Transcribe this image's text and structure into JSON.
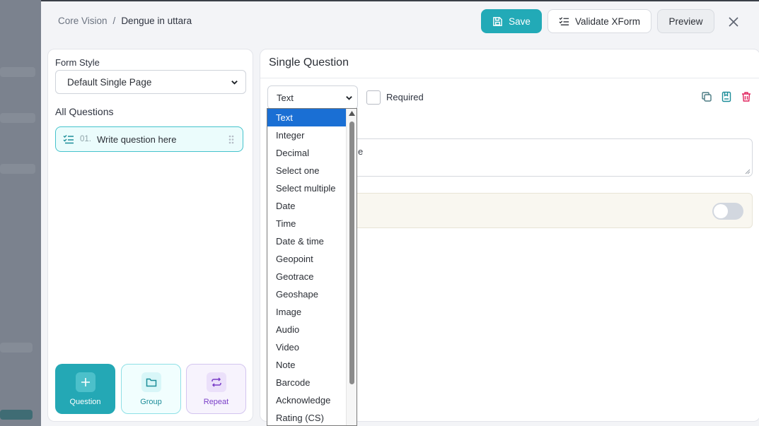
{
  "breadcrumb": {
    "parent": "Core Vision",
    "separator": "/",
    "current": "Dengue in uttara"
  },
  "toolbar": {
    "save_label": "Save",
    "validate_label": "Validate XForm",
    "preview_label": "Preview"
  },
  "sidebar": {
    "form_style_label": "Form Style",
    "form_style_value": "Default Single Page",
    "all_questions_label": "All Questions",
    "questions": [
      {
        "number": "01.",
        "text": "Write question here"
      }
    ],
    "add_buttons": {
      "question": "Question",
      "group": "Group",
      "repeat": "Repeat"
    }
  },
  "main": {
    "title": "Single Question",
    "question_type": "Text",
    "required_label": "Required",
    "question_text_partial": "e"
  },
  "type_dropdown": {
    "options": [
      "Text",
      "Integer",
      "Decimal",
      "Select one",
      "Select multiple",
      "Date",
      "Time",
      "Date & time",
      "Geopoint",
      "Geotrace",
      "Geoshape",
      "Image",
      "Audio",
      "Video",
      "Note",
      "Barcode",
      "Acknowledge",
      "Rating (CS)"
    ],
    "selected": "Text"
  },
  "colors": {
    "accent": "#22aab7",
    "delete": "#e0245e",
    "selected_option": "#1a6fd4",
    "repeat": "#7a3ec8"
  }
}
